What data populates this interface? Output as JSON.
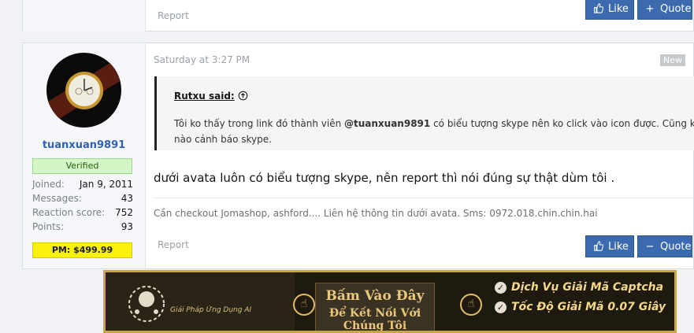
{
  "prev_post": {
    "report_label": "Report",
    "like_label": "Like",
    "quote_label": "Quote"
  },
  "post": {
    "timestamp": "Saturday at 3:27 PM",
    "new_badge": "New",
    "user": {
      "username": "tuanxuan9891",
      "title": "Verified",
      "stats": [
        {
          "label": "Joined:",
          "value": "Jan 9, 2011"
        },
        {
          "label": "Messages:",
          "value": "43"
        },
        {
          "label": "Reaction score:",
          "value": "752"
        },
        {
          "label": "Points:",
          "value": "93"
        }
      ],
      "pm_badge": "PM: $499.99"
    },
    "quote": {
      "author": "Rutxu said:",
      "text_before": "Tôi ko thấy trong link đó thành viên ",
      "mention": "@tuanxuan9891",
      "text_after": " có biểu tượng skype nên ko click vào icon được. Cũng ko có dòng",
      "text_line2": "nào cảnh báo skype."
    },
    "message": "dưới avata luôn có biểu tượng skype, nên report thì nói đúng sự thật dùm tôi .",
    "signature": "Cần checkout Jomashop, ashford.... Liên hệ thông tin dưới avata. Sms: 0972.018.chin.chin.hai",
    "report_label": "Report",
    "like_label": "Like",
    "quote_label": "Quote"
  },
  "banner": {
    "brand_line": "Giải Pháp Ứng Dụng AI",
    "cta_line1": "Bấm Vào Đây",
    "cta_line2": "Để Kết Nối Với Chúng Tôi",
    "features": [
      "Dịch Vụ Giải Mã Captcha",
      "Tốc Độ Giải Mã 0.07 Giây"
    ]
  },
  "colors": {
    "button": "#3c6aaf",
    "username": "#2f62b0",
    "verified_bg": "#d2f6c6",
    "pm_bg": "#faf00e",
    "banner_gold": "#c7a646"
  }
}
